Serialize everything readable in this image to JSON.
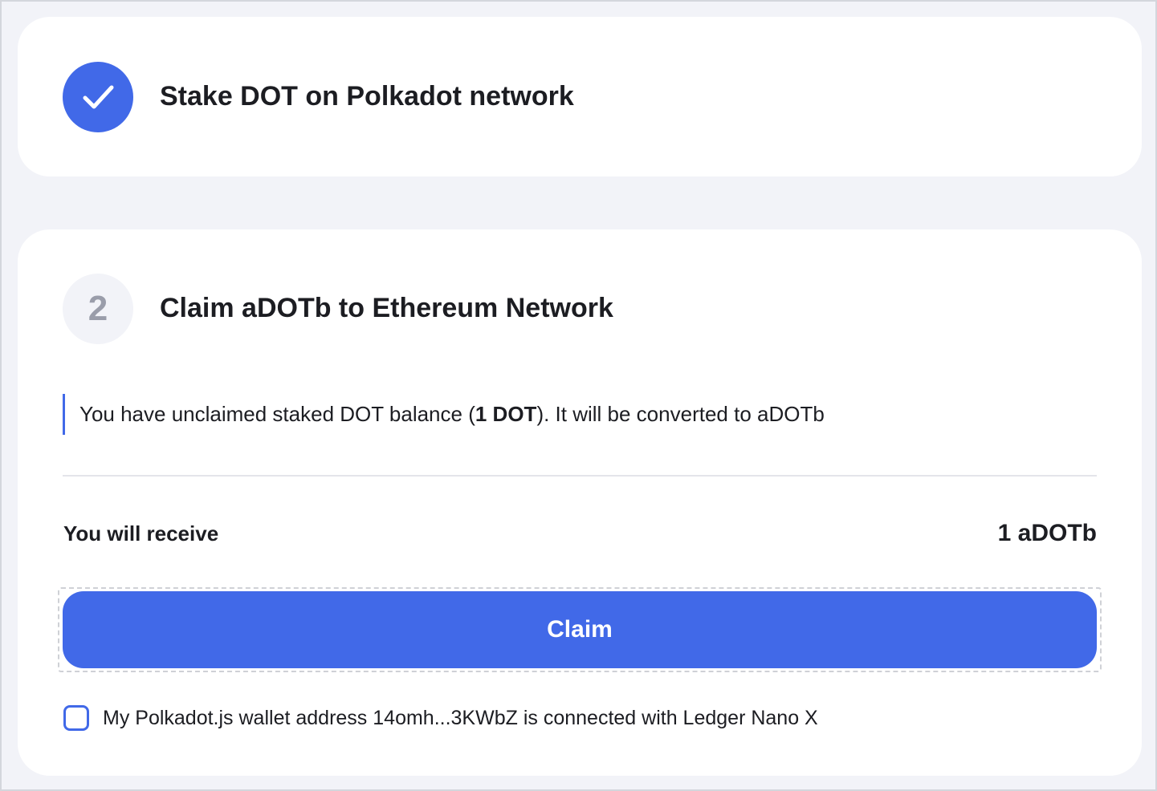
{
  "step1": {
    "status_icon": "check-icon",
    "title": "Stake DOT on Polkadot network"
  },
  "step2": {
    "number": "2",
    "title": "Claim aDOTb to Ethereum Network",
    "notice": {
      "prefix": "You have unclaimed staked DOT balance (",
      "amount": "1 DOT",
      "suffix": "). It will be converted to aDOTb"
    },
    "receive_label": "You will receive",
    "receive_value": "1 aDOTb",
    "claim_label": "Claim",
    "ledger_checkbox": {
      "checked": false,
      "label": "My Polkadot.js wallet address 14omh...3KWbZ is connected with Ledger Nano X"
    }
  },
  "colors": {
    "accent": "#4169e8",
    "background": "#f2f3f8",
    "card": "#ffffff",
    "text": "#1c1d22",
    "muted": "#9a9daa"
  }
}
